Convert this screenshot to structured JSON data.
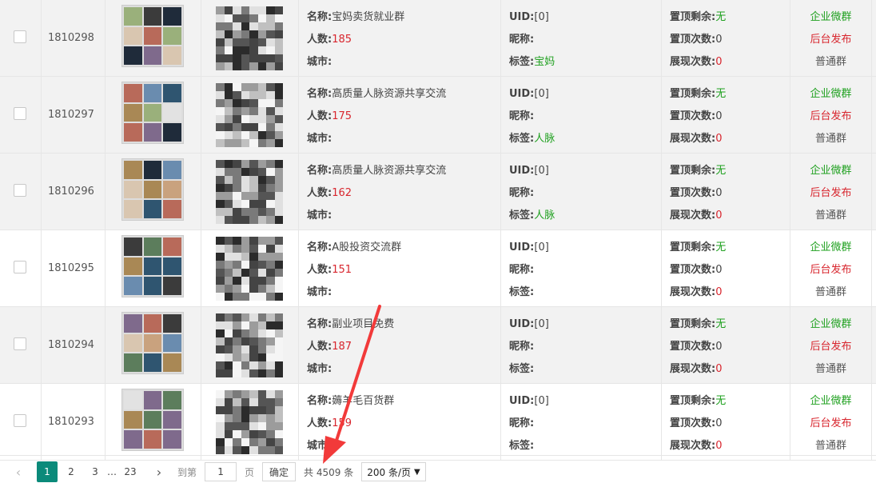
{
  "rows": [
    {
      "id": "1810298",
      "name": "宝妈卖货就业群",
      "count": "185",
      "city": "",
      "uid": "[0]",
      "nickname": "",
      "tag": "宝妈",
      "top_remain": "无",
      "top_times": "0",
      "show_times": "0",
      "shade": true
    },
    {
      "id": "1810297",
      "name": "高质量人脉资源共享交流",
      "count": "175",
      "city": "",
      "uid": "[0]",
      "nickname": "",
      "tag": "人脉",
      "top_remain": "无",
      "top_times": "0",
      "show_times": "0",
      "shade": true
    },
    {
      "id": "1810296",
      "name": "高质量人脉资源共享交流",
      "count": "162",
      "city": "",
      "uid": "[0]",
      "nickname": "",
      "tag": "人脉",
      "top_remain": "无",
      "top_times": "0",
      "show_times": "0",
      "shade": true
    },
    {
      "id": "1810295",
      "name": "A股投资交流群",
      "count": "151",
      "city": "",
      "uid": "[0]",
      "nickname": "",
      "tag": "",
      "top_remain": "无",
      "top_times": "0",
      "show_times": "0",
      "shade": false
    },
    {
      "id": "1810294",
      "name": "副业项目免费",
      "count": "187",
      "city": "",
      "uid": "[0]",
      "nickname": "",
      "tag": "",
      "top_remain": "无",
      "top_times": "0",
      "show_times": "0",
      "shade": true
    },
    {
      "id": "1810293",
      "name": "薅羊毛百货群",
      "count": "159",
      "city": "",
      "uid": "[0]",
      "nickname": "",
      "tag": "",
      "top_remain": "无",
      "top_times": "0",
      "show_times": "0",
      "shade": false
    }
  ],
  "labels": {
    "name": "名称:",
    "count": "人数:",
    "city": "城市:",
    "uid": "UID:",
    "nickname": "昵称:",
    "tag": "标签:",
    "top_remain": "置顶剩余:",
    "top_times": "置顶次数:",
    "show_times": "展现次数:"
  },
  "actions": {
    "enterprise": "企业微群",
    "publish": "后台发布",
    "normal": "普通群"
  },
  "pager": {
    "prev": "‹",
    "pages": [
      "1",
      "2",
      "3"
    ],
    "ellipsis": "…",
    "last": "23",
    "next": "›",
    "goto_label": "到第",
    "goto_value": "1",
    "page_unit": "页",
    "confirm": "确定",
    "total": "共 4509 条",
    "page_size": "200 条/页",
    "current_page": "1"
  },
  "colors": {
    "accent": "#0b8a7a",
    "green": "#1ea01e",
    "red": "#d8262e"
  }
}
